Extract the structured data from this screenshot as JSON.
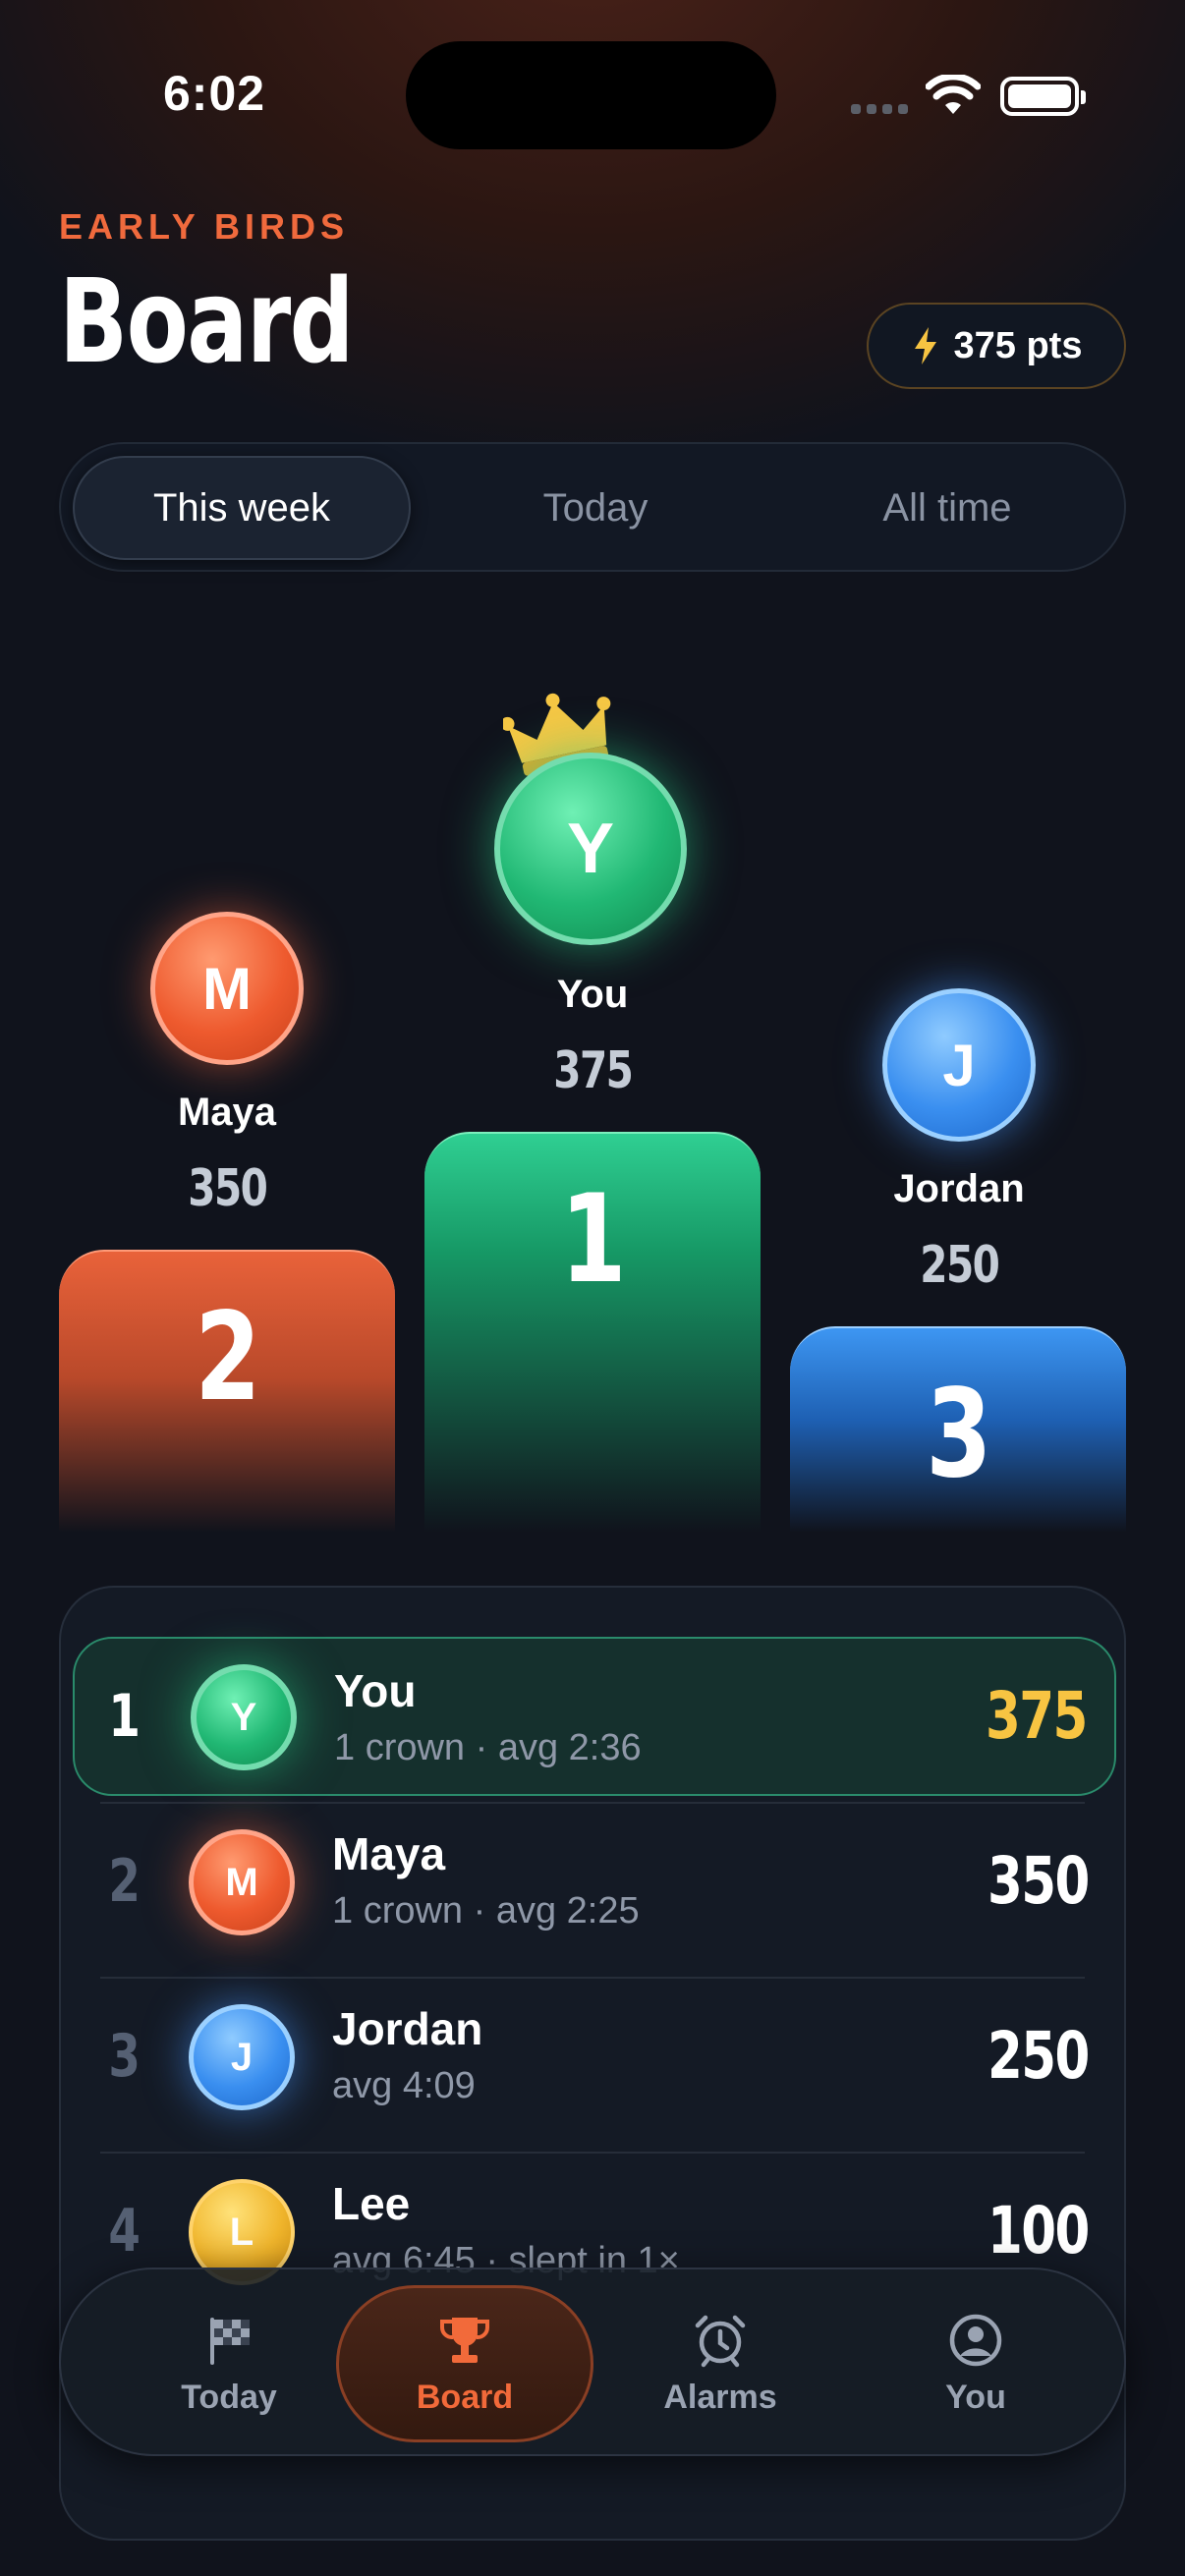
{
  "status_bar": {
    "time": "6:02"
  },
  "header": {
    "eyebrow": "EARLY BIRDS",
    "title": "Board",
    "points": "375 pts"
  },
  "segments": [
    "This week",
    "Today",
    "All time"
  ],
  "podium": [
    {
      "rank": "1",
      "initial": "Y",
      "name": "You",
      "score": "375"
    },
    {
      "rank": "2",
      "initial": "M",
      "name": "Maya",
      "score": "350"
    },
    {
      "rank": "3",
      "initial": "J",
      "name": "Jordan",
      "score": "250"
    }
  ],
  "leaderboard": [
    {
      "rank": "1",
      "initial": "Y",
      "name": "You",
      "detail": "1 crown · avg 2:36",
      "score": "375"
    },
    {
      "rank": "2",
      "initial": "M",
      "name": "Maya",
      "detail": "1 crown · avg 2:25",
      "score": "350"
    },
    {
      "rank": "3",
      "initial": "J",
      "name": "Jordan",
      "detail": "avg 4:09",
      "score": "250"
    },
    {
      "rank": "4",
      "initial": "L",
      "name": "Lee",
      "detail": "avg 6:45 · slept in 1×",
      "score": "100"
    }
  ],
  "tabbar": [
    "Today",
    "Board",
    "Alarms",
    "You"
  ],
  "colors": {
    "accent": "#f06a3d",
    "gold": "#f7c442",
    "green": "#21b874",
    "blue": "#3a8ff0"
  }
}
